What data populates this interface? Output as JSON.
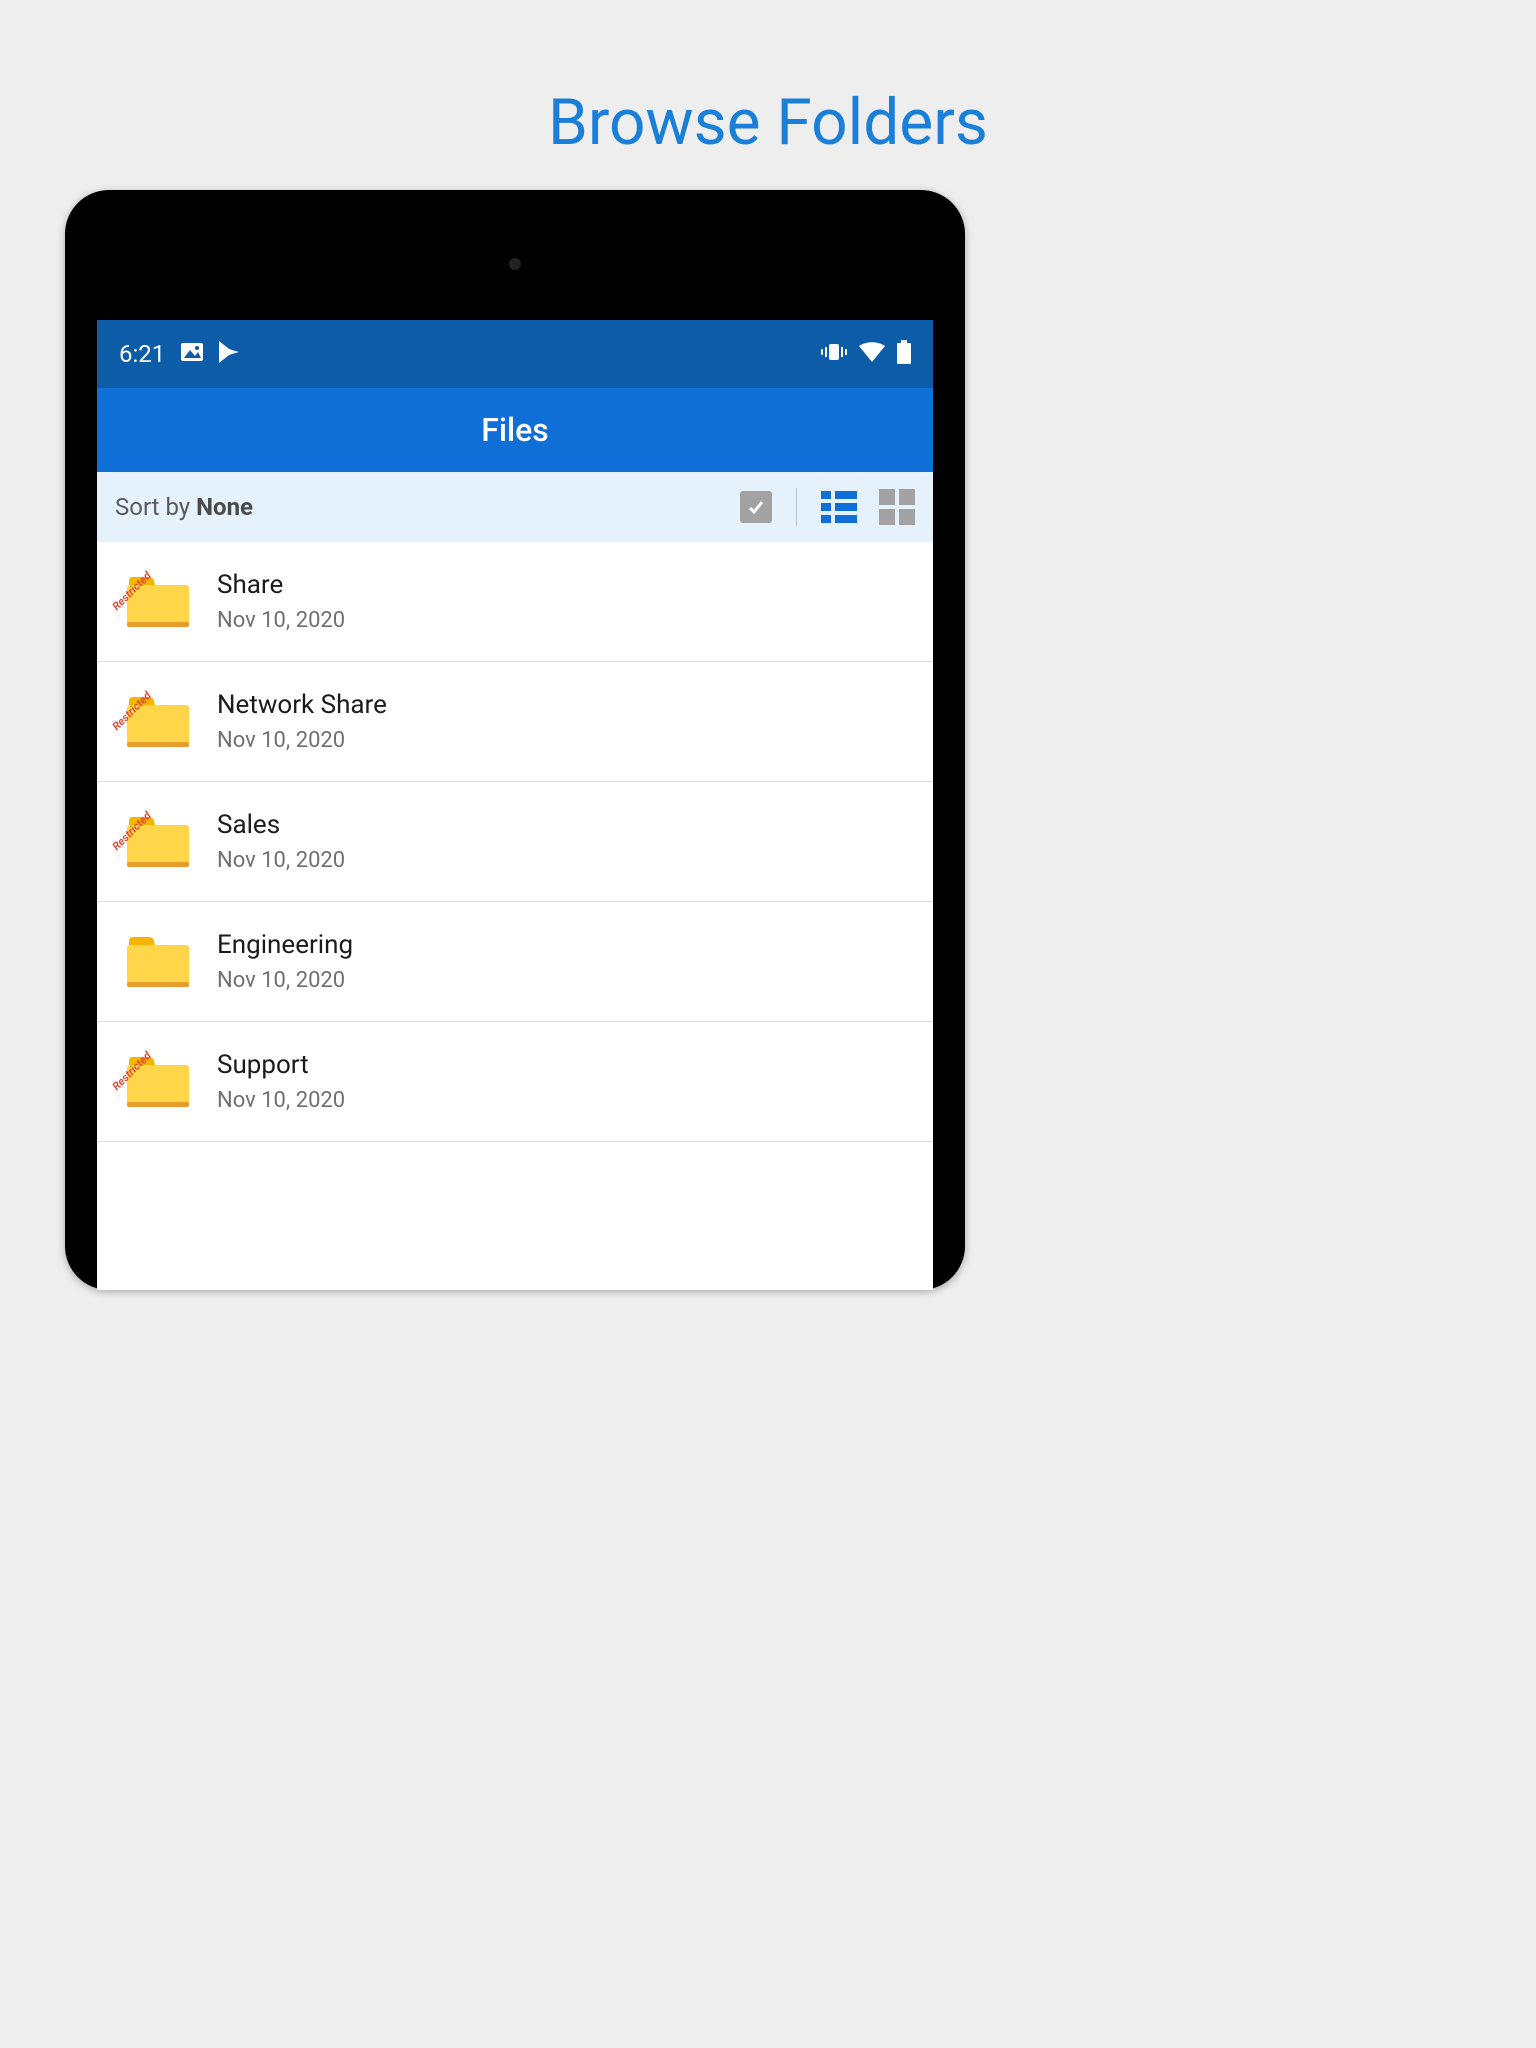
{
  "page": {
    "title": "Browse Folders"
  },
  "status": {
    "time": "6:21"
  },
  "header": {
    "title": "Files"
  },
  "sort": {
    "prefix": "Sort by ",
    "value": "None"
  },
  "folders": [
    {
      "name": "Share",
      "date": "Nov 10, 2020",
      "restricted": true,
      "restricted_label": "Restricted"
    },
    {
      "name": "Network Share",
      "date": "Nov 10, 2020",
      "restricted": true,
      "restricted_label": "Restricted"
    },
    {
      "name": "Sales",
      "date": "Nov 10, 2020",
      "restricted": true,
      "restricted_label": "Restricted"
    },
    {
      "name": "Engineering",
      "date": "Nov 10, 2020",
      "restricted": false
    },
    {
      "name": "Support",
      "date": "Nov 10, 2020",
      "restricted": true,
      "restricted_label": "Restricted"
    }
  ]
}
